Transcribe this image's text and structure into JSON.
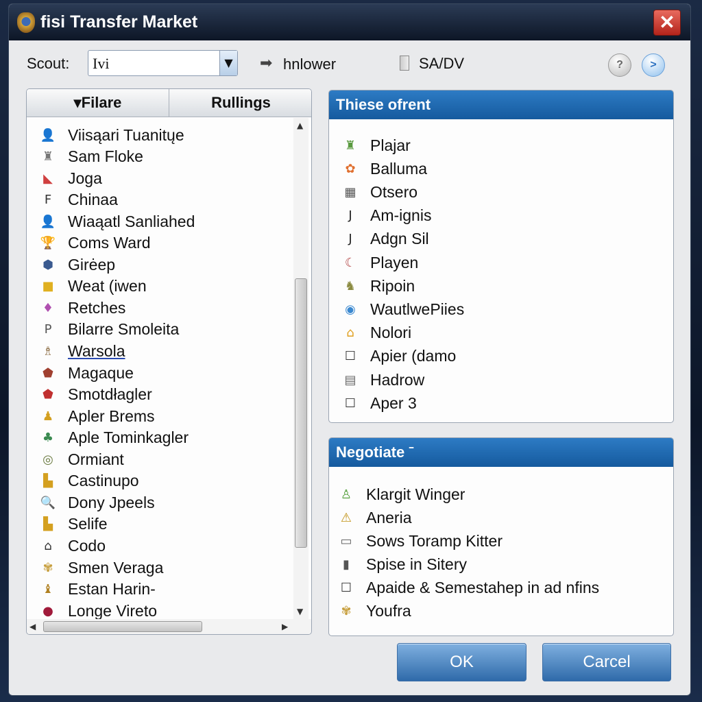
{
  "window": {
    "title": "fisi Transfer Market",
    "close": "✕"
  },
  "toolbar": {
    "scout_label": "Scout:",
    "scout_value": "Ivi",
    "follower": "hnlower",
    "follower_arrow": "➡",
    "checkbox_label": "SA/DV",
    "help": "?",
    "next": ">"
  },
  "left_panel": {
    "columns": [
      "▾Filare",
      "Rullings"
    ],
    "items": [
      {
        "label": "Viisąari Tuanitųe",
        "icon": "person-icon",
        "glyph": "👤",
        "color": "#4a7a3a"
      },
      {
        "label": "Sam Floke",
        "icon": "team-icon",
        "glyph": "♜",
        "color": "#777"
      },
      {
        "label": "Joga",
        "icon": "boot-icon",
        "glyph": "◣",
        "color": "#d04040"
      },
      {
        "label": "Chinaa",
        "icon": "letter-icon",
        "glyph": "F",
        "color": "#333"
      },
      {
        "label": "Wiaąatl Sanliahed",
        "icon": "person-icon",
        "glyph": "👤",
        "color": "#2a5ab0"
      },
      {
        "label": "Coms Ward",
        "icon": "trophy-icon",
        "glyph": "🏆",
        "color": "#d4a020"
      },
      {
        "label": "Girėep",
        "icon": "crest-icon",
        "glyph": "⬢",
        "color": "#3a5a90"
      },
      {
        "label": "Weat (iwen",
        "icon": "badge-icon",
        "glyph": "■",
        "color": "#e0b020"
      },
      {
        "label": "Retches",
        "icon": "player-icon",
        "glyph": "♦",
        "color": "#b050b0"
      },
      {
        "label": "Bilarre Smoleita",
        "icon": "flag-icon",
        "glyph": "P",
        "color": "#555"
      },
      {
        "label": "Warsola",
        "icon": "trophy-icon",
        "glyph": "♗",
        "color": "#8a6a40"
      },
      {
        "label": "Magaque",
        "icon": "shield-icon",
        "glyph": "⬟",
        "color": "#a04030"
      },
      {
        "label": "Smotdłagler",
        "icon": "shield-icon",
        "glyph": "⬟",
        "color": "#c03030"
      },
      {
        "label": "Apler Brems",
        "icon": "player-icon",
        "glyph": "♟",
        "color": "#d4a020"
      },
      {
        "label": "Aple Tominkagler",
        "icon": "tree-icon",
        "glyph": "♣",
        "color": "#3a8a50"
      },
      {
        "label": "Ormiant",
        "icon": "ring-icon",
        "glyph": "◎",
        "color": "#6a7a40"
      },
      {
        "label": "Castinupo",
        "icon": "stadium-icon",
        "glyph": "▙",
        "color": "#d4a020"
      },
      {
        "label": "Dony Jpeels",
        "icon": "search-icon",
        "glyph": "🔍",
        "color": "#d4a020"
      },
      {
        "label": "Selife",
        "icon": "stadium-icon",
        "glyph": "▙",
        "color": "#d4a020"
      },
      {
        "label": "Codo",
        "icon": "building-icon",
        "glyph": "⌂",
        "color": "#333"
      },
      {
        "label": "Smen Veraga",
        "icon": "eagle-icon",
        "glyph": "✾",
        "color": "#c8a040"
      },
      {
        "label": "Estan Harin-",
        "icon": "statue-icon",
        "glyph": "♝",
        "color": "#b08020"
      },
      {
        "label": "Longe Vireto",
        "icon": "club-crest-icon",
        "glyph": "●",
        "color": "#a01a3a"
      }
    ]
  },
  "offer_panel": {
    "title": "Thiese ofrent",
    "items": [
      {
        "label": "Plajar",
        "icon": "team-icon",
        "glyph": "♜",
        "color": "#5a9a40"
      },
      {
        "label": "Balluma",
        "icon": "ball-icon",
        "glyph": "✿",
        "color": "#e07030"
      },
      {
        "label": "Otsero",
        "icon": "grid-icon",
        "glyph": "▦",
        "color": "#555"
      },
      {
        "label": "Am-ignis",
        "icon": "letter-icon",
        "glyph": "J",
        "color": "#222"
      },
      {
        "label": "Adgn Sil",
        "icon": "letter-icon",
        "glyph": "J",
        "color": "#222"
      },
      {
        "label": "Playen",
        "icon": "moon-icon",
        "glyph": "☾",
        "color": "#b04040"
      },
      {
        "label": "Ripoin",
        "icon": "player-icon",
        "glyph": "♞",
        "color": "#8a8a40"
      },
      {
        "label": "WautlwePiies",
        "icon": "target-icon",
        "glyph": "◉",
        "color": "#3a88d0"
      },
      {
        "label": "Nolori",
        "icon": "home-icon",
        "glyph": "⌂",
        "color": "#e0a020"
      },
      {
        "label": "Apier (damo",
        "icon": "checkbox-icon",
        "glyph": "☐",
        "color": "#333"
      },
      {
        "label": "Hadrow",
        "icon": "card-icon",
        "glyph": "▤",
        "color": "#666"
      },
      {
        "label": "Aper 3",
        "icon": "checkbox-icon",
        "glyph": "☐",
        "color": "#333"
      }
    ]
  },
  "negotiate_panel": {
    "title": "Negotiate ˉ",
    "items": [
      {
        "label": "Klargit Winger",
        "icon": "flask-icon",
        "glyph": "♙",
        "color": "#4a9a30"
      },
      {
        "label": "Aneria",
        "icon": "warning-icon",
        "glyph": "⚠",
        "color": "#c09010"
      },
      {
        "label": "Sows Toramp Kitter",
        "icon": "window-icon",
        "glyph": "▭",
        "color": "#666"
      },
      {
        "label": "Spise in Sitery",
        "icon": "document-icon",
        "glyph": "▮",
        "color": "#555"
      },
      {
        "label": "Apaide & Semestahep in ad nfins",
        "icon": "checkbox-icon",
        "glyph": "☐",
        "color": "#333"
      },
      {
        "label": "Youfra",
        "icon": "eagle-icon",
        "glyph": "✾",
        "color": "#c8a040"
      }
    ]
  },
  "buttons": {
    "ok": "OK",
    "cancel": "Carcel"
  }
}
